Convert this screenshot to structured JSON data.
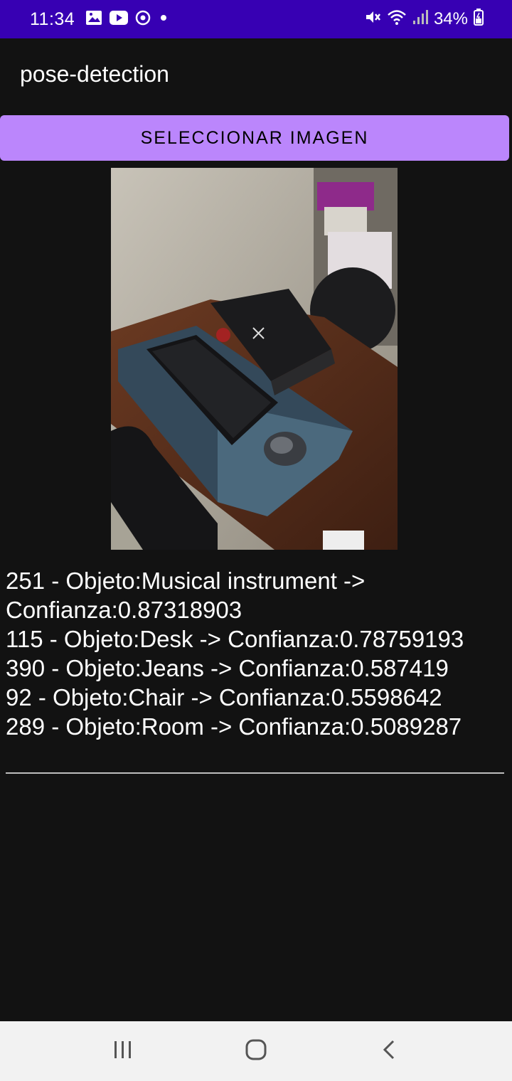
{
  "status_bar": {
    "time": "11:34",
    "battery": "34%",
    "icons_left": [
      "gallery-icon",
      "youtube-icon",
      "sync-icon",
      "dot-icon"
    ],
    "icons_right": [
      "mute-icon",
      "wifi-icon",
      "signal-icon",
      "battery-icon"
    ]
  },
  "app": {
    "title": "pose-detection"
  },
  "actions": {
    "select_image_label": "SELECCIONAR IMAGEN"
  },
  "results": [
    "251 - Objeto:Musical instrument -> Confianza:0.87318903",
    "115 - Objeto:Desk -> Confianza:0.78759193",
    "390 - Objeto:Jeans -> Confianza:0.587419",
    "92 - Objeto:Chair -> Confianza:0.5598642",
    "289 - Objeto:Room -> Confianza:0.5089287"
  ],
  "navigation": {
    "buttons": [
      "recents-icon",
      "home-icon",
      "back-icon"
    ]
  },
  "colors": {
    "status_bar": "#3700B3",
    "background": "#121212",
    "button": "#BB86FC",
    "nav_bar": "#f2f2f2"
  }
}
